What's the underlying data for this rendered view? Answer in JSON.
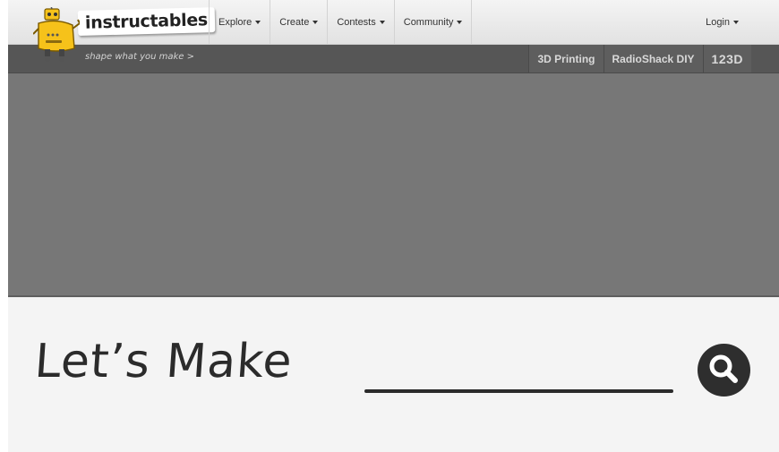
{
  "brand": {
    "logo_text": "instructables",
    "tagline": "shape what you make >"
  },
  "nav": {
    "items": [
      {
        "label": "Explore"
      },
      {
        "label": "Create"
      },
      {
        "label": "Contests"
      },
      {
        "label": "Community"
      }
    ],
    "login_label": "Login"
  },
  "partners": {
    "items": [
      {
        "label": "3D Printing"
      },
      {
        "label": "RadioShack DIY"
      },
      {
        "label": "123D"
      }
    ]
  },
  "make": {
    "prompt": "Let’s Make"
  },
  "icons": {
    "mascot": "robot-mascot-icon",
    "search": "search-icon",
    "caret": "caret-down-icon"
  },
  "colors": {
    "brand_yellow": "#f6c21a",
    "hero_gray": "#777777",
    "subbar_gray": "#565656"
  }
}
